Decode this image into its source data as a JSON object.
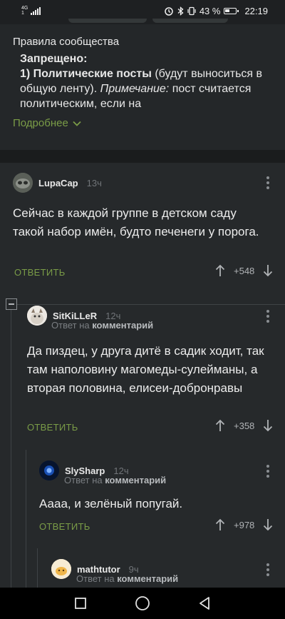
{
  "status_bar": {
    "network": "4G",
    "network_sub": "1",
    "battery_percent": "43 %",
    "time": "22:19"
  },
  "rules": {
    "title": "Правила сообщества",
    "heading": "Запрещено:",
    "item_bold": "1) Политические посты",
    "item_text": " (будут выноситься в общую ленту). ",
    "note_label": "Примечание:",
    "note_text": " пост считается политическим, если на",
    "more_label": "Подробнее"
  },
  "comments": [
    {
      "user": "LupaCap",
      "time": "13ч",
      "text": "Сейчас в каждой группе в детском саду такой набор имён, будто печенеги у порога.",
      "reply_label": "ОТВЕТИТЬ",
      "rating": "+548"
    },
    {
      "user": "SitKiLLeR",
      "time": "12ч",
      "reply_prefix": "Ответ на ",
      "reply_target": "комментарий",
      "text": "Да пиздец, у друга дитё в садик ходит, так там наполовину магомеды-сулейманы, а вторая половина, елисеи-добронравы",
      "reply_label": "ОТВЕТИТЬ",
      "rating": "+358"
    },
    {
      "user": "SlySharp",
      "time": "12ч",
      "reply_prefix": "Ответ на ",
      "reply_target": "комментарий",
      "text": "Аааа, и зелёный попугай.",
      "reply_label": "ОТВЕТИТЬ",
      "rating": "+978"
    },
    {
      "user": "mathtutor",
      "time": "9ч",
      "reply_prefix": "Ответ на ",
      "reply_target": "комментарий"
    }
  ],
  "colors": {
    "accent_green": "#7a9c47",
    "background": "#1e2022",
    "card": "#26292b"
  }
}
